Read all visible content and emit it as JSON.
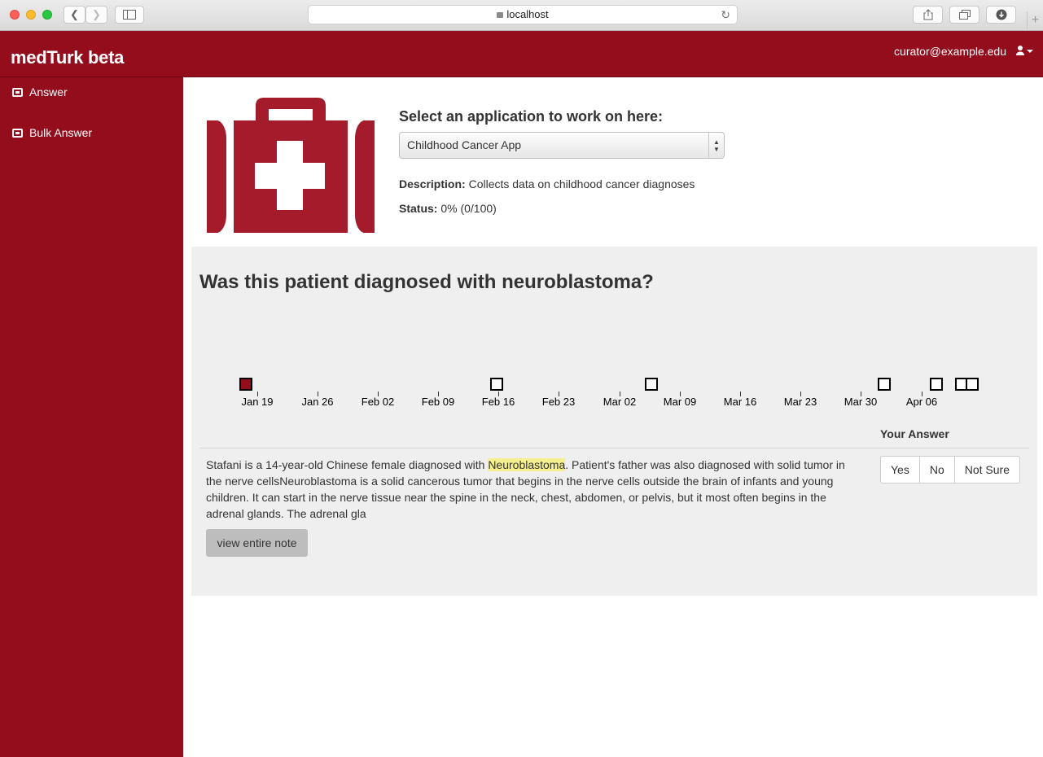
{
  "browser": {
    "url": "localhost"
  },
  "app": {
    "brand": "medTurk beta",
    "user_email": "curator@example.edu",
    "accent_color": "#930d1c"
  },
  "sidebar": {
    "items": [
      {
        "label": "Answer",
        "icon": "medkit-icon"
      },
      {
        "label": "Bulk Answer",
        "icon": "medkit-icon"
      }
    ]
  },
  "application": {
    "select_label": "Select an application to work on here:",
    "selected": "Childhood Cancer App",
    "description_label": "Description:",
    "description": "Collects data on childhood cancer diagnoses",
    "status_label": "Status:",
    "status": "0% (0/100)"
  },
  "question": {
    "text": "Was this patient diagnosed with neuroblastoma?"
  },
  "timeline": {
    "tick_labels": [
      "Jan 19",
      "Jan 26",
      "Feb 02",
      "Feb 09",
      "Feb 16",
      "Feb 23",
      "Mar 02",
      "Mar 09",
      "Mar 16",
      "Mar 23",
      "Mar 30",
      "Apr 06"
    ],
    "note_markers": [
      {
        "active": true
      },
      {
        "active": false
      },
      {
        "active": false
      },
      {
        "active": false
      },
      {
        "active": false
      },
      {
        "active": false
      },
      {
        "active": false
      }
    ]
  },
  "answer": {
    "heading": "Your Answer",
    "options": [
      "Yes",
      "No",
      "Not Sure"
    ]
  },
  "note": {
    "before": "Stafani is a 14-year-old Chinese female diagnosed with ",
    "highlight": "Neuroblastoma",
    "after": ". Patient's father was also diagnosed with solid tumor in the nerve cellsNeuroblastoma is a solid cancerous tumor that begins in the nerve cells outside the brain of infants and young children. It can start in the nerve tissue near the spine in the neck, chest, abdomen, or pelvis, but it most often begins in the adrenal glands. The adrenal gla",
    "view_button": "view entire note"
  }
}
